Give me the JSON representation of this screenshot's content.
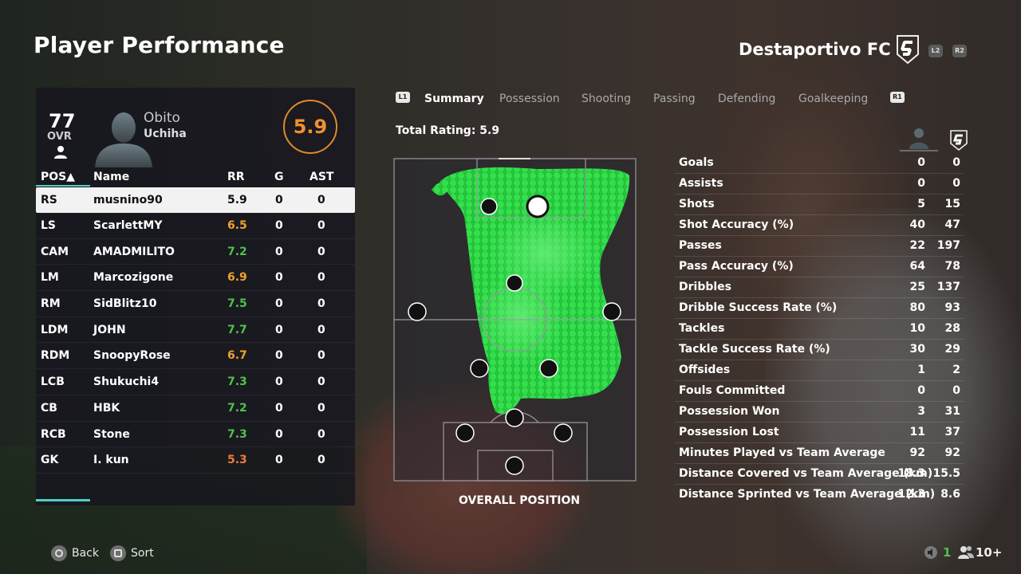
{
  "screen": {
    "title": "Player Performance",
    "team_name": "Destaportivo FC",
    "header_keys": [
      "L2",
      "R2"
    ]
  },
  "player": {
    "ovr": "77",
    "ovr_label": "OVR",
    "first_name": "Obito",
    "last_name": "Uchiha",
    "rating": "5.9"
  },
  "table": {
    "headers": {
      "pos": "POS▲",
      "name": "Name",
      "rr": "RR",
      "g": "G",
      "ast": "AST"
    },
    "rows": [
      {
        "pos": "RS",
        "name": "musnino90",
        "rr": "5.9",
        "g": "0",
        "ast": "0",
        "rr_color": "#111111"
      },
      {
        "pos": "LS",
        "name": "ScarlettMY",
        "rr": "6.5",
        "g": "0",
        "ast": "0",
        "rr_color": "#f0a22e"
      },
      {
        "pos": "CAM",
        "name": "AMADMILITO",
        "rr": "7.2",
        "g": "0",
        "ast": "0",
        "rr_color": "#4fc24a"
      },
      {
        "pos": "LM",
        "name": "Marcozigone",
        "rr": "6.9",
        "g": "0",
        "ast": "0",
        "rr_color": "#f0a22e"
      },
      {
        "pos": "RM",
        "name": "SidBlitz10",
        "rr": "7.5",
        "g": "0",
        "ast": "0",
        "rr_color": "#4fc24a"
      },
      {
        "pos": "LDM",
        "name": "JOHN",
        "rr": "7.7",
        "g": "0",
        "ast": "0",
        "rr_color": "#4fc24a"
      },
      {
        "pos": "RDM",
        "name": "SnoopyRose",
        "rr": "6.7",
        "g": "0",
        "ast": "0",
        "rr_color": "#f0a22e"
      },
      {
        "pos": "LCB",
        "name": "Shukuchi4",
        "rr": "7.3",
        "g": "0",
        "ast": "0",
        "rr_color": "#4fc24a"
      },
      {
        "pos": "CB",
        "name": "HBK",
        "rr": "7.2",
        "g": "0",
        "ast": "0",
        "rr_color": "#4fc24a"
      },
      {
        "pos": "RCB",
        "name": "Stone",
        "rr": "7.3",
        "g": "0",
        "ast": "0",
        "rr_color": "#4fc24a"
      },
      {
        "pos": "GK",
        "name": "I. kun",
        "rr": "5.3",
        "g": "0",
        "ast": "0",
        "rr_color": "#f07a3e"
      }
    ]
  },
  "tabs": {
    "left_key": "L1",
    "right_key": "R1",
    "items": [
      "Summary",
      "Possession",
      "Shooting",
      "Passing",
      "Defending",
      "Goalkeeping"
    ],
    "active": "Summary"
  },
  "total_rating_label": "Total Rating: 5.9",
  "pitch_label": "OVERALL POSITION",
  "stats": [
    {
      "label": "Goals",
      "player": "0",
      "team": "0"
    },
    {
      "label": "Assists",
      "player": "0",
      "team": "0"
    },
    {
      "label": "Shots",
      "player": "5",
      "team": "15"
    },
    {
      "label": "Shot Accuracy (%)",
      "player": "40",
      "team": "47"
    },
    {
      "label": "Passes",
      "player": "22",
      "team": "197"
    },
    {
      "label": "Pass Accuracy (%)",
      "player": "64",
      "team": "78"
    },
    {
      "label": "Dribbles",
      "player": "25",
      "team": "137"
    },
    {
      "label": "Dribble Success Rate (%)",
      "player": "80",
      "team": "93"
    },
    {
      "label": "Tackles",
      "player": "10",
      "team": "28"
    },
    {
      "label": "Tackle Success Rate (%)",
      "player": "30",
      "team": "29"
    },
    {
      "label": "Offsides",
      "player": "1",
      "team": "2"
    },
    {
      "label": "Fouls Committed",
      "player": "0",
      "team": "0"
    },
    {
      "label": "Possession Won",
      "player": "3",
      "team": "31"
    },
    {
      "label": "Possession Lost",
      "player": "11",
      "team": "37"
    },
    {
      "label": "Minutes Played vs Team Average",
      "player": "92",
      "team": "92"
    },
    {
      "label": "Distance Covered vs Team Average (km)",
      "player": "18.3",
      "team": "15.5"
    },
    {
      "label": "Distance Sprinted vs Team Average (km)",
      "player": "12.3",
      "team": "8.6"
    }
  ],
  "bottom": {
    "back_label": "Back",
    "sort_label": "Sort",
    "count": "1",
    "party": "10+"
  },
  "colors": {
    "accent_teal": "#4fd1c5",
    "rating_orange": "#f0912e",
    "heatmap_green": "#2ee84a"
  }
}
